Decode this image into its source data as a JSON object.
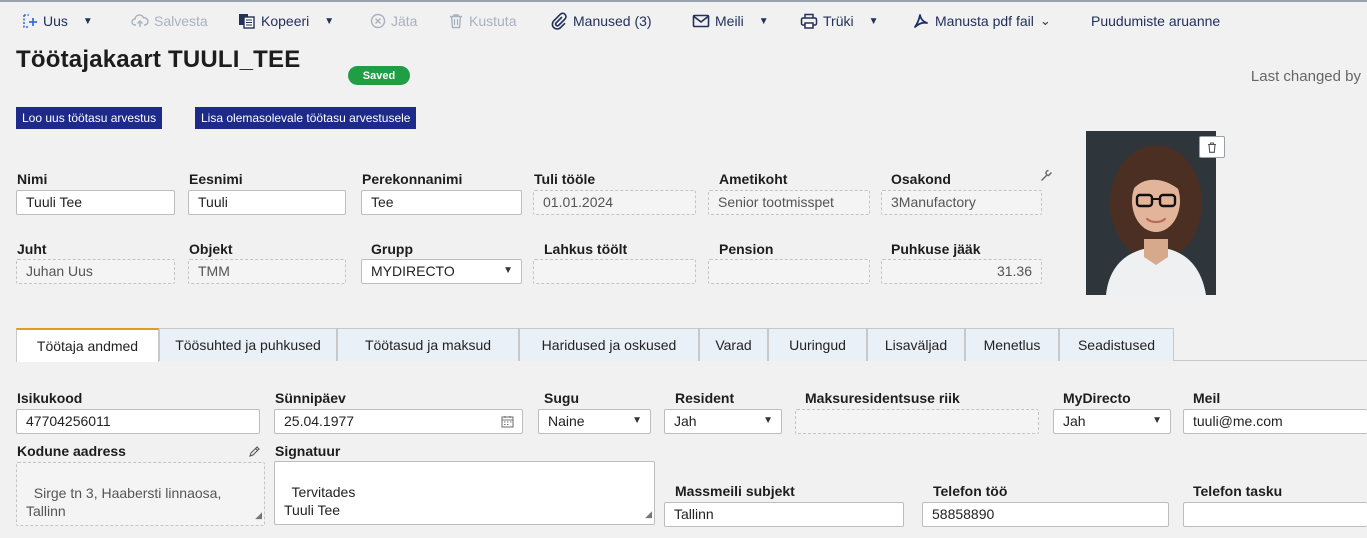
{
  "toolbar": {
    "new": "Uus",
    "save": "Salvesta",
    "copy": "Kopeeri",
    "cancel": "Jäta",
    "delete": "Kustuta",
    "attachments": "Manused (3)",
    "email": "Meili",
    "print": "Trüki",
    "attach_pdf": "Manusta pdf fail",
    "absence_report": "Puudumiste aruanne"
  },
  "header": {
    "title": "Töötajakaart TUULI_TEE",
    "status": "Saved",
    "last_changed": "Last changed by"
  },
  "actions": {
    "new_payroll": "Loo uus töötasu arvestus",
    "add_payroll": "Lisa olemasolevale töötasu arvestusele"
  },
  "fields": {
    "nimi": {
      "label": "Nimi",
      "value": "Tuuli Tee"
    },
    "eesnimi": {
      "label": "Eesnimi",
      "value": "Tuuli"
    },
    "perekonnanimi": {
      "label": "Perekonnanimi",
      "value": "Tee"
    },
    "tuli_toole": {
      "label": "Tuli tööle",
      "value": "01.01.2024"
    },
    "ametikoht": {
      "label": "Ametikoht",
      "value": "Senior tootmisspet"
    },
    "osakond": {
      "label": "Osakond",
      "value": "3Manufactory"
    },
    "juht": {
      "label": "Juht",
      "value": "Juhan Uus"
    },
    "objekt": {
      "label": "Objekt",
      "value": "TMM"
    },
    "grupp": {
      "label": "Grupp",
      "value": "MYDIRECTO"
    },
    "lahkus": {
      "label": "Lahkus töölt",
      "value": ""
    },
    "pension": {
      "label": "Pension",
      "value": ""
    },
    "puhkuse_jaak": {
      "label": "Puhkuse jääk",
      "value": "31.36"
    }
  },
  "tabs": [
    "Töötaja andmed",
    "Töösuhted ja puhkused",
    "Töötasud ja maksud",
    "Haridused ja oskused",
    "Varad",
    "Uuringud",
    "Lisaväljad",
    "Menetlus",
    "Seadistused"
  ],
  "details": {
    "isikukood": {
      "label": "Isikukood",
      "value": "47704256011"
    },
    "synnipaev": {
      "label": "Sünnipäev",
      "value": "25.04.1977"
    },
    "sugu": {
      "label": "Sugu",
      "value": "Naine"
    },
    "resident": {
      "label": "Resident",
      "value": "Jah"
    },
    "maksuresidentsus": {
      "label": "Maksuresidentsuse riik",
      "value": ""
    },
    "mydirecto": {
      "label": "MyDirecto",
      "value": "Jah"
    },
    "meil": {
      "label": "Meil",
      "value": "tuuli@me.com"
    },
    "kodune_aadress": {
      "label": "Kodune aadress",
      "value": "Sirge tn 3, Haabersti linnaosa,\nTallinn"
    },
    "signatuur": {
      "label": "Signatuur",
      "value": "Tervitades\nTuuli Tee"
    },
    "massmeili_subjekt": {
      "label": "Massmeili subjekt",
      "value": "Tallinn"
    },
    "telefon_too": {
      "label": "Telefon töö",
      "value": "58858890"
    },
    "telefon_tasku": {
      "label": "Telefon tasku",
      "value": ""
    }
  },
  "colors": {
    "toolbar_text": "#23305a",
    "primary_button": "#1e2a8a",
    "saved_badge": "#1f9e44",
    "active_tab_accent": "#e39a1e",
    "tab_background": "#eaf0f7"
  }
}
